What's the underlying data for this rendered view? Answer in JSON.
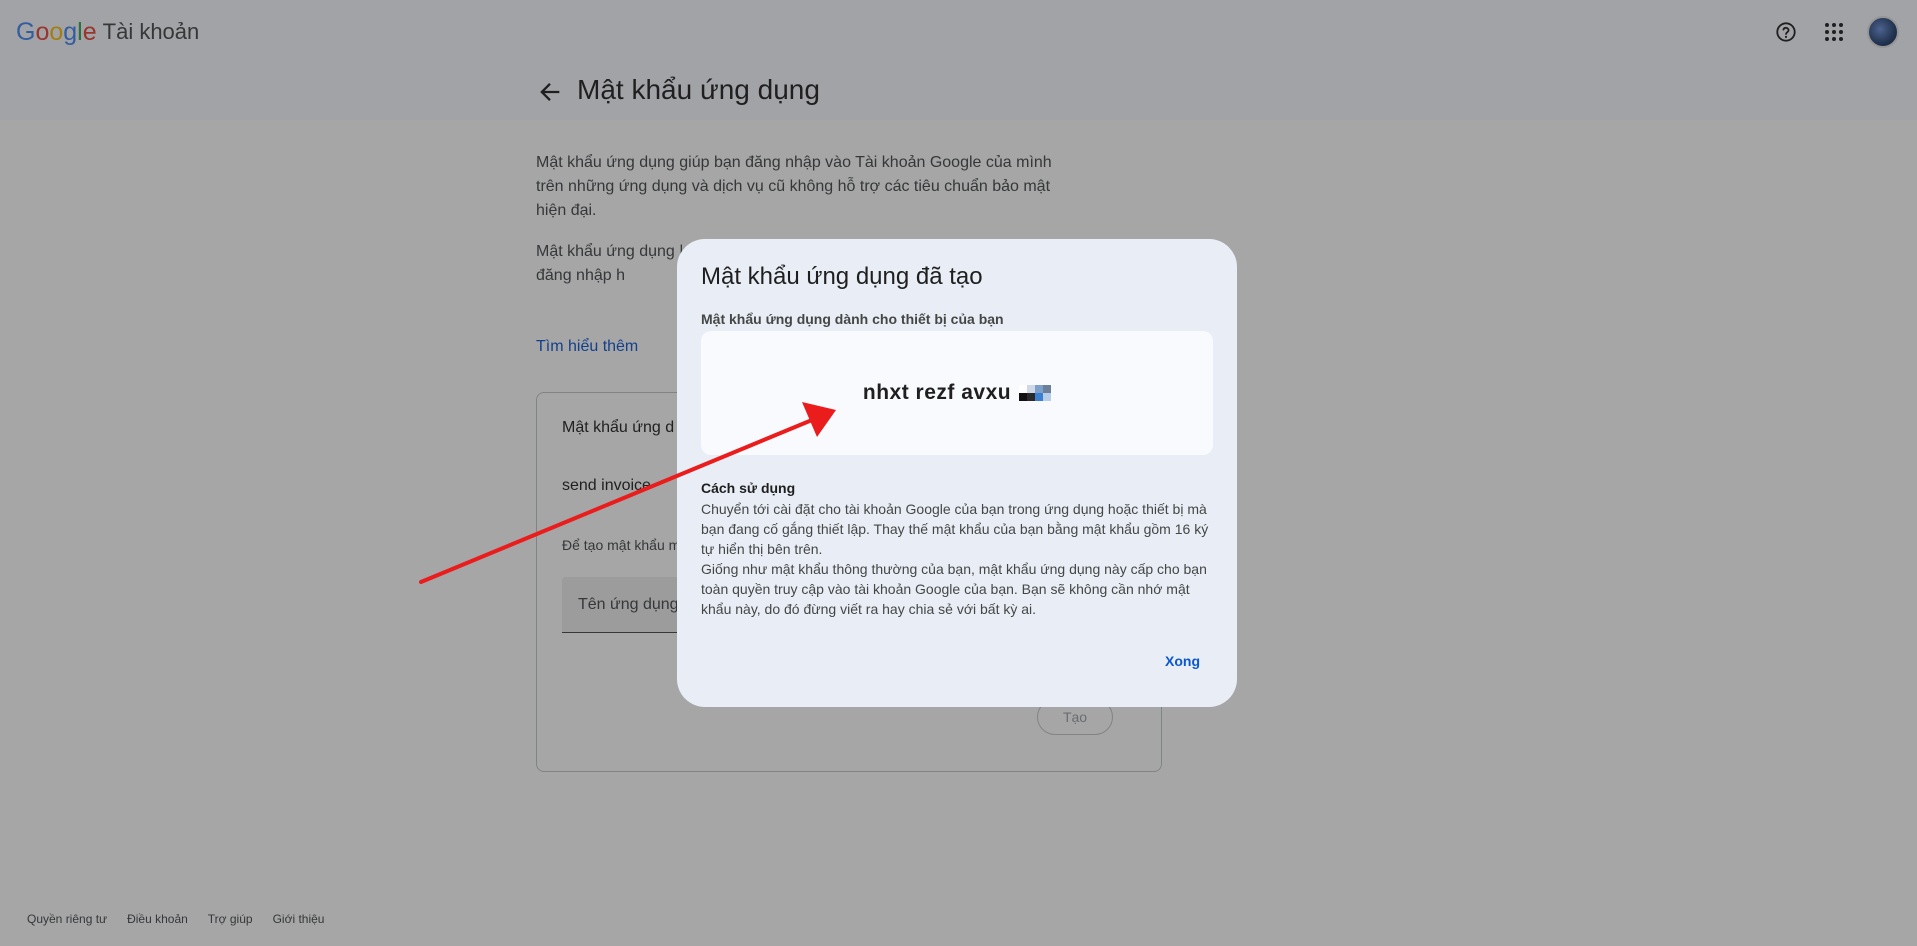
{
  "header": {
    "logo_text": "Google",
    "product": "Tài khoản",
    "icons": [
      "help-icon",
      "apps-grid-icon",
      "account-avatar"
    ]
  },
  "page": {
    "title": "Mật khẩu ứng dụng",
    "intro_1": "Mật khẩu ứng dụng giúp bạn đăng nhập vào Tài khoản Google của mình trên những ứng dụng và dịch vụ cũ không hỗ trợ các tiêu chuẩn bảo mật hiện đại.",
    "intro_2_visible": "Mật khẩu ứng dụng | dịch vụ mới nhất hỗ | khẩu ứng dụng, bạn | này để đăng nhập h",
    "learn_more": "Tìm hiểu thêm"
  },
  "app_box": {
    "title": "Mật khẩu ứng d",
    "app_name": "send invoice",
    "hint": "Để tạo mật khẩu m dưới...",
    "input_placeholder": "Tên ứng dụng",
    "create_button": "Tạo"
  },
  "footer": {
    "links": [
      "Quyền riêng tư",
      "Điều khoản",
      "Trợ giúp",
      "Giới thiệu"
    ]
  },
  "dialog": {
    "title": "Mật khẩu ứng dụng đã tạo",
    "password_label": "Mật khẩu ứng dụng dành cho thiết bị của bạn",
    "password_value": "nhxt rezf avxu",
    "how_to_title": "Cách sử dụng",
    "how_to_p1": "Chuyển tới cài đặt cho tài khoản Google của bạn trong ứng dụng hoặc thiết bị mà bạn đang cố gắng thiết lập. Thay thế mật khẩu của bạn bằng mật khẩu gồm 16 ký tự hiển thị bên trên.",
    "how_to_p2": "Giống như mật khẩu thông thường của bạn, mật khẩu ứng dụng này cấp cho bạn toàn quyền truy cập vào tài khoản Google của bạn. Bạn sẽ không cần nhớ mật khẩu này, do đó đừng viết ra hay chia sẻ với bất kỳ ai.",
    "done_button": "Xong"
  },
  "colors": {
    "accent": "#0b57d0",
    "scrim": "rgba(32,33,36,0.40)",
    "dialog_bg": "#e9eef6",
    "annotation_arrow": "#ea1c1c"
  }
}
